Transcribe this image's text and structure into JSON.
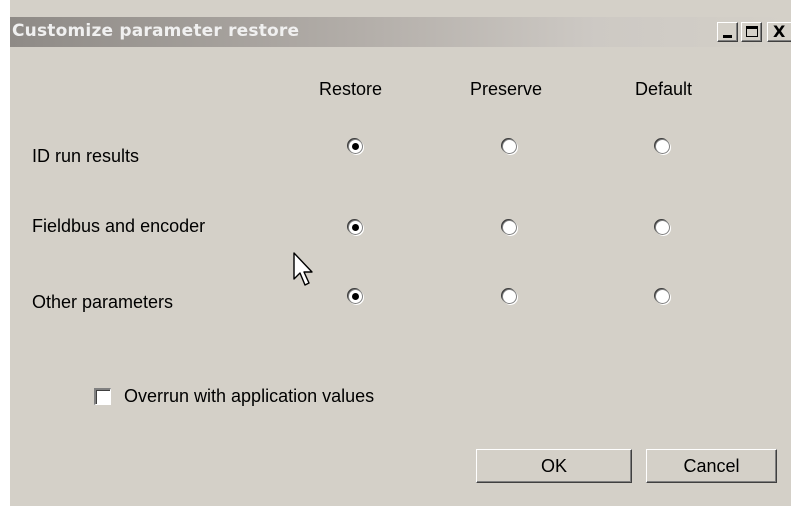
{
  "window": {
    "title": "Customize parameter restore",
    "controls": {
      "minimize_icon": "minimize-icon",
      "maximize_icon": "maximize-icon",
      "close_glyph": "X"
    }
  },
  "columns": [
    "Restore",
    "Preserve",
    "Default"
  ],
  "rows": [
    {
      "label": "ID run results",
      "selected": "Restore"
    },
    {
      "label": "Fieldbus and encoder",
      "selected": "Restore"
    },
    {
      "label": "Other parameters",
      "selected": "Restore"
    }
  ],
  "checkbox": {
    "label": "Overrun with application values",
    "checked": false
  },
  "buttons": {
    "ok": "OK",
    "cancel": "Cancel"
  },
  "colors": {
    "face": "#d4d0c8",
    "title_gradient_start": "#8e8a86"
  }
}
